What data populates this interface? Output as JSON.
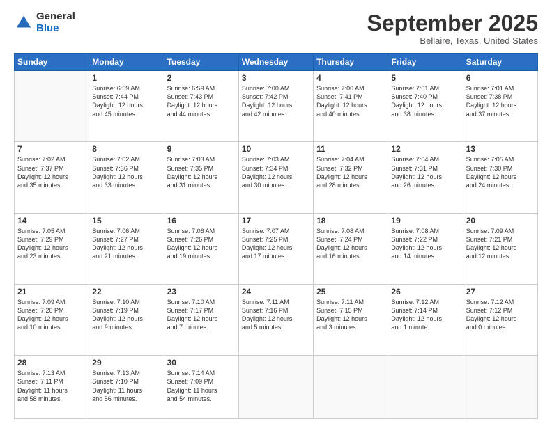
{
  "logo": {
    "general": "General",
    "blue": "Blue"
  },
  "header": {
    "month": "September 2025",
    "location": "Bellaire, Texas, United States"
  },
  "weekdays": [
    "Sunday",
    "Monday",
    "Tuesday",
    "Wednesday",
    "Thursday",
    "Friday",
    "Saturday"
  ],
  "weeks": [
    [
      {
        "day": "",
        "info": ""
      },
      {
        "day": "1",
        "info": "Sunrise: 6:59 AM\nSunset: 7:44 PM\nDaylight: 12 hours\nand 45 minutes."
      },
      {
        "day": "2",
        "info": "Sunrise: 6:59 AM\nSunset: 7:43 PM\nDaylight: 12 hours\nand 44 minutes."
      },
      {
        "day": "3",
        "info": "Sunrise: 7:00 AM\nSunset: 7:42 PM\nDaylight: 12 hours\nand 42 minutes."
      },
      {
        "day": "4",
        "info": "Sunrise: 7:00 AM\nSunset: 7:41 PM\nDaylight: 12 hours\nand 40 minutes."
      },
      {
        "day": "5",
        "info": "Sunrise: 7:01 AM\nSunset: 7:40 PM\nDaylight: 12 hours\nand 38 minutes."
      },
      {
        "day": "6",
        "info": "Sunrise: 7:01 AM\nSunset: 7:38 PM\nDaylight: 12 hours\nand 37 minutes."
      }
    ],
    [
      {
        "day": "7",
        "info": "Sunrise: 7:02 AM\nSunset: 7:37 PM\nDaylight: 12 hours\nand 35 minutes."
      },
      {
        "day": "8",
        "info": "Sunrise: 7:02 AM\nSunset: 7:36 PM\nDaylight: 12 hours\nand 33 minutes."
      },
      {
        "day": "9",
        "info": "Sunrise: 7:03 AM\nSunset: 7:35 PM\nDaylight: 12 hours\nand 31 minutes."
      },
      {
        "day": "10",
        "info": "Sunrise: 7:03 AM\nSunset: 7:34 PM\nDaylight: 12 hours\nand 30 minutes."
      },
      {
        "day": "11",
        "info": "Sunrise: 7:04 AM\nSunset: 7:32 PM\nDaylight: 12 hours\nand 28 minutes."
      },
      {
        "day": "12",
        "info": "Sunrise: 7:04 AM\nSunset: 7:31 PM\nDaylight: 12 hours\nand 26 minutes."
      },
      {
        "day": "13",
        "info": "Sunrise: 7:05 AM\nSunset: 7:30 PM\nDaylight: 12 hours\nand 24 minutes."
      }
    ],
    [
      {
        "day": "14",
        "info": "Sunrise: 7:05 AM\nSunset: 7:29 PM\nDaylight: 12 hours\nand 23 minutes."
      },
      {
        "day": "15",
        "info": "Sunrise: 7:06 AM\nSunset: 7:27 PM\nDaylight: 12 hours\nand 21 minutes."
      },
      {
        "day": "16",
        "info": "Sunrise: 7:06 AM\nSunset: 7:26 PM\nDaylight: 12 hours\nand 19 minutes."
      },
      {
        "day": "17",
        "info": "Sunrise: 7:07 AM\nSunset: 7:25 PM\nDaylight: 12 hours\nand 17 minutes."
      },
      {
        "day": "18",
        "info": "Sunrise: 7:08 AM\nSunset: 7:24 PM\nDaylight: 12 hours\nand 16 minutes."
      },
      {
        "day": "19",
        "info": "Sunrise: 7:08 AM\nSunset: 7:22 PM\nDaylight: 12 hours\nand 14 minutes."
      },
      {
        "day": "20",
        "info": "Sunrise: 7:09 AM\nSunset: 7:21 PM\nDaylight: 12 hours\nand 12 minutes."
      }
    ],
    [
      {
        "day": "21",
        "info": "Sunrise: 7:09 AM\nSunset: 7:20 PM\nDaylight: 12 hours\nand 10 minutes."
      },
      {
        "day": "22",
        "info": "Sunrise: 7:10 AM\nSunset: 7:19 PM\nDaylight: 12 hours\nand 9 minutes."
      },
      {
        "day": "23",
        "info": "Sunrise: 7:10 AM\nSunset: 7:17 PM\nDaylight: 12 hours\nand 7 minutes."
      },
      {
        "day": "24",
        "info": "Sunrise: 7:11 AM\nSunset: 7:16 PM\nDaylight: 12 hours\nand 5 minutes."
      },
      {
        "day": "25",
        "info": "Sunrise: 7:11 AM\nSunset: 7:15 PM\nDaylight: 12 hours\nand 3 minutes."
      },
      {
        "day": "26",
        "info": "Sunrise: 7:12 AM\nSunset: 7:14 PM\nDaylight: 12 hours\nand 1 minute."
      },
      {
        "day": "27",
        "info": "Sunrise: 7:12 AM\nSunset: 7:12 PM\nDaylight: 12 hours\nand 0 minutes."
      }
    ],
    [
      {
        "day": "28",
        "info": "Sunrise: 7:13 AM\nSunset: 7:11 PM\nDaylight: 11 hours\nand 58 minutes."
      },
      {
        "day": "29",
        "info": "Sunrise: 7:13 AM\nSunset: 7:10 PM\nDaylight: 11 hours\nand 56 minutes."
      },
      {
        "day": "30",
        "info": "Sunrise: 7:14 AM\nSunset: 7:09 PM\nDaylight: 11 hours\nand 54 minutes."
      },
      {
        "day": "",
        "info": ""
      },
      {
        "day": "",
        "info": ""
      },
      {
        "day": "",
        "info": ""
      },
      {
        "day": "",
        "info": ""
      }
    ]
  ]
}
